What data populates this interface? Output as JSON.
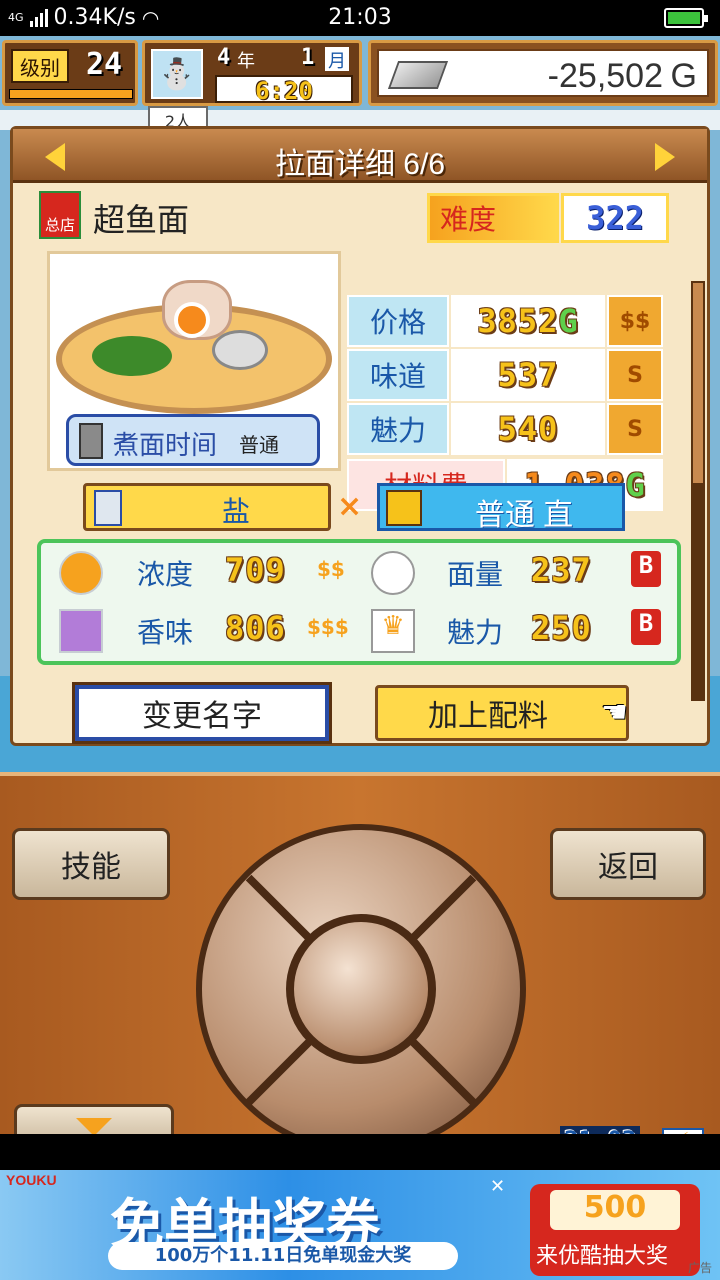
{
  "status_bar": {
    "network": "4G",
    "speed": "0.34K/s",
    "time": "21:03"
  },
  "hud": {
    "level_label": "级别",
    "level_value": "24",
    "year_value": "4",
    "year_label": "年",
    "month_value": "1",
    "month_label": "月",
    "clock": "6:20",
    "money": "-25,502",
    "money_unit": "G"
  },
  "background_text": {
    "tab_fragment": "2人"
  },
  "panel": {
    "title": "拉面详细 6/6",
    "shop_badge": "总店",
    "dish_name": "超鱼面",
    "difficulty_label": "难度",
    "difficulty_value": "322",
    "stats": [
      {
        "label": "价格",
        "value": "3852",
        "suffix": "G",
        "coin": "$$"
      },
      {
        "label": "味道",
        "value": "537",
        "suffix": "",
        "coin": "S"
      },
      {
        "label": "魅力",
        "value": "540",
        "suffix": "",
        "coin": "S"
      }
    ],
    "cost_label": "材料费",
    "cost_value": "1,038",
    "cost_suffix": "G",
    "cook_time_label": "煮面时间",
    "cook_time_value": "普通",
    "soup": "盐",
    "cross": "×",
    "noodle": "普通 直",
    "attributes": [
      {
        "label": "浓度",
        "value": "709",
        "coin": "$$",
        "icon": "sun-icon"
      },
      {
        "label": "面量",
        "value": "237",
        "grade": "B",
        "icon": "rice-icon"
      },
      {
        "label": "香味",
        "value": "806",
        "coin": "$$$",
        "icon": "aroma-icon"
      },
      {
        "label": "魅力",
        "value": "250",
        "grade": "B",
        "icon": "crown-icon"
      }
    ],
    "rename_button": "变更名字",
    "add_topping_button": "加上配料"
  },
  "controls": {
    "skills_button": "技能",
    "back_button": "返回",
    "game_clock": "21:03"
  },
  "ad": {
    "brand": "YOUKU",
    "headline": "免单抽奖券",
    "subline": "100万个11.11日免单现金大奖",
    "ticket_value": "500",
    "cta": "来优酷抽大奖",
    "ad_tag": "广告"
  },
  "colors": {
    "panel_bg": "#f7e7c6",
    "stat_label": "#1a58a8",
    "stat_value": "#f6c21a",
    "cost_label": "#d6271e",
    "wood": "#c8752f"
  }
}
